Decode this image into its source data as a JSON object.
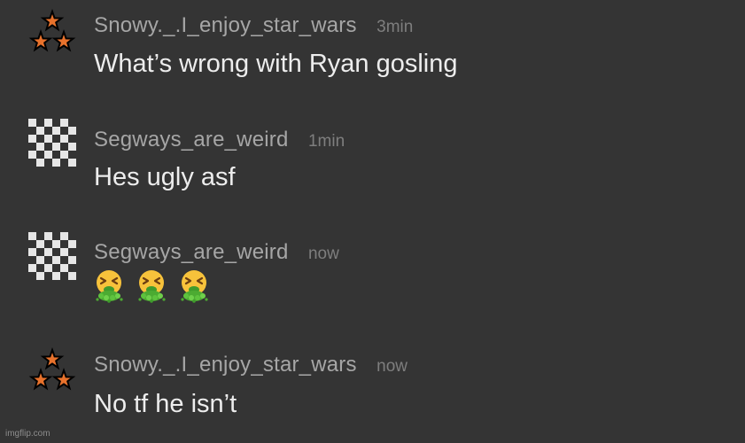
{
  "comments": [
    {
      "username": "Snowy._.I_enjoy_star_wars",
      "time": "3min",
      "text": "What’s wrong with Ryan gosling",
      "avatar_icon": "three-stars-icon"
    },
    {
      "username": "Segways_are_weird",
      "time": "1min",
      "text": "Hes ugly asf",
      "avatar_icon": "checkerboard-icon"
    },
    {
      "username": "Segways_are_weird",
      "time": "now",
      "emoji_count": 3,
      "emoji_icon": "vomiting-face-icon",
      "avatar_icon": "checkerboard-icon"
    },
    {
      "username": "Snowy._.I_enjoy_star_wars",
      "time": "now",
      "text": "No tf he isn’t",
      "avatar_icon": "three-stars-icon"
    }
  ],
  "watermark": "imgflip.com",
  "colors": {
    "background": "#343434",
    "username": "#a6a6a6",
    "timestamp": "#7e7e7e",
    "message": "#ededed",
    "star_fill": "#e8722c"
  }
}
